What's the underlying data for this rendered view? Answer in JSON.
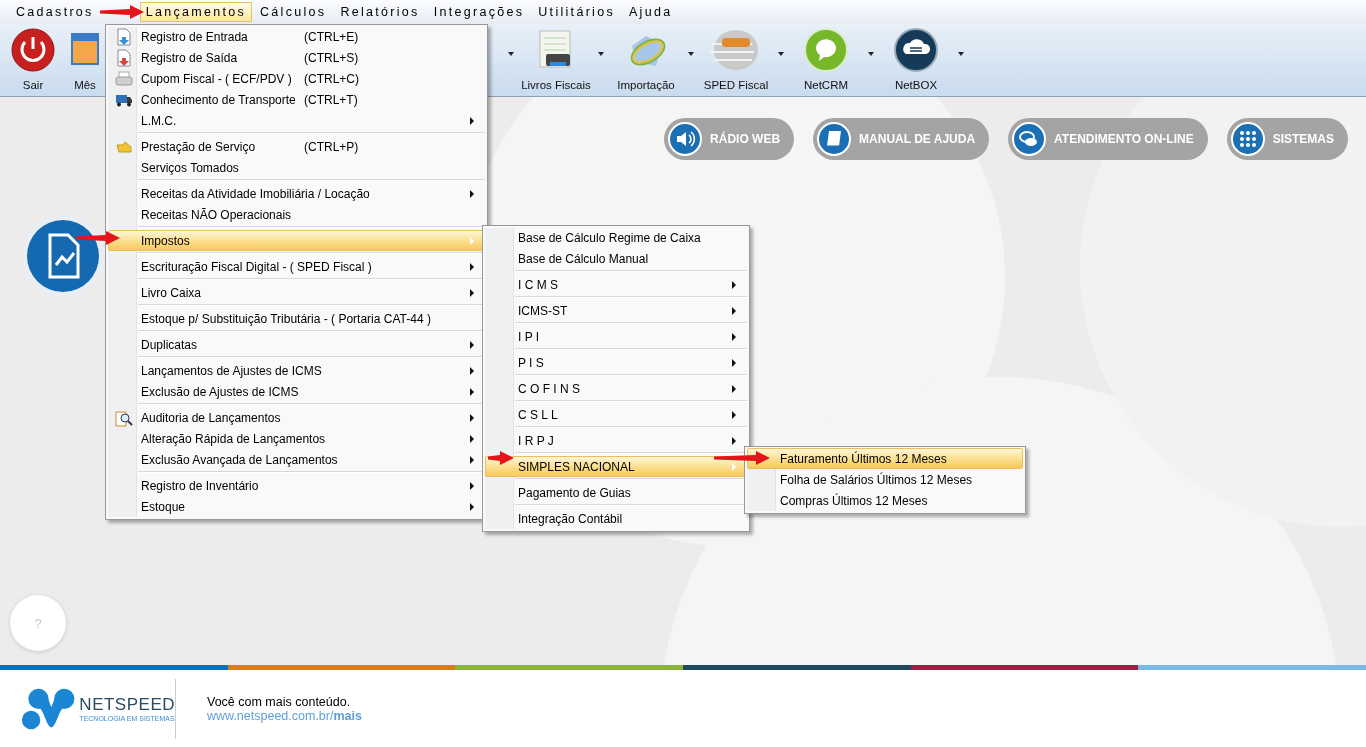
{
  "menubar": [
    {
      "label": "Cadastros",
      "selected": false
    },
    {
      "label": "Lançamentos",
      "selected": true
    },
    {
      "label": "Cálculos",
      "selected": false
    },
    {
      "label": "Relatórios",
      "selected": false
    },
    {
      "label": "Integrações",
      "selected": false
    },
    {
      "label": "Utilitários",
      "selected": false
    },
    {
      "label": "Ajuda",
      "selected": false
    }
  ],
  "toolbar": {
    "left": [
      {
        "kind": "button",
        "label": "Sair"
      },
      {
        "kind": "button",
        "label": "Mês"
      }
    ],
    "right": [
      {
        "kind": "caret"
      },
      {
        "kind": "button",
        "label": "Livros Fiscais",
        "dropdown": true
      },
      {
        "kind": "button",
        "label": "Importação",
        "dropdown": true
      },
      {
        "kind": "button",
        "label": "SPED Fiscal",
        "dropdown": true
      },
      {
        "kind": "button",
        "label": "NetCRM",
        "dropdown": true
      },
      {
        "kind": "button",
        "label": "NetBOX",
        "dropdown": true
      }
    ]
  },
  "menu": {
    "groups": [
      [
        {
          "label": "Registro de Entrada",
          "shortcut": "(CTRL+E)",
          "submenu": false,
          "selected": false
        },
        {
          "label": "Registro de Saída",
          "shortcut": "(CTRL+S)",
          "submenu": false,
          "selected": false
        },
        {
          "label": "Cupom Fiscal - ( ECF/PDV )",
          "shortcut": "(CTRL+C)",
          "submenu": false,
          "selected": false
        },
        {
          "label": "Conhecimento de Transporte",
          "shortcut": "(CTRL+T)",
          "submenu": false,
          "selected": false
        },
        {
          "label": "L.M.C.",
          "submenu": true,
          "selected": false
        }
      ],
      [
        {
          "label": "Prestação de Serviço",
          "shortcut": "(CTRL+P)",
          "submenu": false,
          "selected": false
        },
        {
          "label": "Serviços Tomados",
          "submenu": false,
          "selected": false
        }
      ],
      [
        {
          "label": "Receitas da Atividade Imobiliária / Locação",
          "submenu": true,
          "selected": false
        },
        {
          "label": "Receitas NÃO Operacionais",
          "submenu": false,
          "selected": false
        }
      ],
      [
        {
          "label": "Impostos",
          "submenu": true,
          "selected": true
        }
      ],
      [
        {
          "label": "Escrituração Fiscal Digital - ( SPED Fiscal )",
          "submenu": true,
          "selected": false
        }
      ],
      [
        {
          "label": "Livro Caixa",
          "submenu": true,
          "selected": false
        }
      ],
      [
        {
          "label": "Estoque p/ Substituição Tributária - ( Portaria CAT-44 )",
          "submenu": false,
          "selected": false
        }
      ],
      [
        {
          "label": "Duplicatas",
          "submenu": true,
          "selected": false
        }
      ],
      [
        {
          "label": "Lançamentos de Ajustes de ICMS",
          "submenu": true,
          "selected": false
        },
        {
          "label": "Exclusão de Ajustes de ICMS",
          "submenu": true,
          "selected": false
        }
      ],
      [
        {
          "label": "Auditoria de Lançamentos",
          "submenu": true,
          "selected": false
        },
        {
          "label": "Alteração Rápida de Lançamentos",
          "submenu": true,
          "selected": false
        },
        {
          "label": "Exclusão Avançada de Lançamentos",
          "submenu": true,
          "selected": false
        }
      ],
      [
        {
          "label": "Registro de Inventário",
          "submenu": true,
          "selected": false
        },
        {
          "label": "Estoque",
          "submenu": true,
          "selected": false
        }
      ]
    ]
  },
  "submenu": {
    "groups": [
      [
        {
          "label": "Base de Cálculo Regime de Caixa",
          "submenu": false,
          "selected": false
        },
        {
          "label": "Base de Cálculo Manual",
          "submenu": false,
          "selected": false
        }
      ],
      [
        {
          "label": "I C M S",
          "submenu": true,
          "selected": false
        }
      ],
      [
        {
          "label": "ICMS-ST",
          "submenu": true,
          "selected": false
        }
      ],
      [
        {
          "label": "I P I",
          "submenu": true,
          "selected": false
        }
      ],
      [
        {
          "label": "P I S",
          "submenu": true,
          "selected": false
        }
      ],
      [
        {
          "label": "C O F I N S",
          "submenu": true,
          "selected": false
        }
      ],
      [
        {
          "label": "C S L L",
          "submenu": true,
          "selected": false
        }
      ],
      [
        {
          "label": "I R P J",
          "submenu": true,
          "selected": false
        }
      ],
      [
        {
          "label": "SIMPLES NACIONAL",
          "submenu": true,
          "selected": true
        }
      ],
      [
        {
          "label": "Pagamento de Guias",
          "submenu": false,
          "selected": false
        }
      ],
      [
        {
          "label": "Integração Contábil",
          "submenu": false,
          "selected": false
        }
      ]
    ]
  },
  "subsubmenu": {
    "groups": [
      [
        {
          "label": "Faturamento Últimos 12 Meses",
          "submenu": false,
          "selected": true
        },
        {
          "label": "Folha de Salários Últimos 12 Meses",
          "submenu": false,
          "selected": false
        },
        {
          "label": "Compras Últimos 12 Meses",
          "submenu": false,
          "selected": false
        }
      ]
    ]
  },
  "quick_buttons": [
    {
      "label": "RÁDIO WEB"
    },
    {
      "label": "MANUAL DE AJUDA"
    },
    {
      "label": "ATENDIMENTO ON-LINE"
    },
    {
      "label": "SISTEMAS"
    }
  ],
  "help_button": {
    "label": "?"
  },
  "footer": {
    "brand": "NETSPEED",
    "tagline": "TECNOLOGIA EM SISTEMAS",
    "headline": "Você com mais conteúdo.",
    "link": "www.netspeed.com.br/**mais**"
  }
}
